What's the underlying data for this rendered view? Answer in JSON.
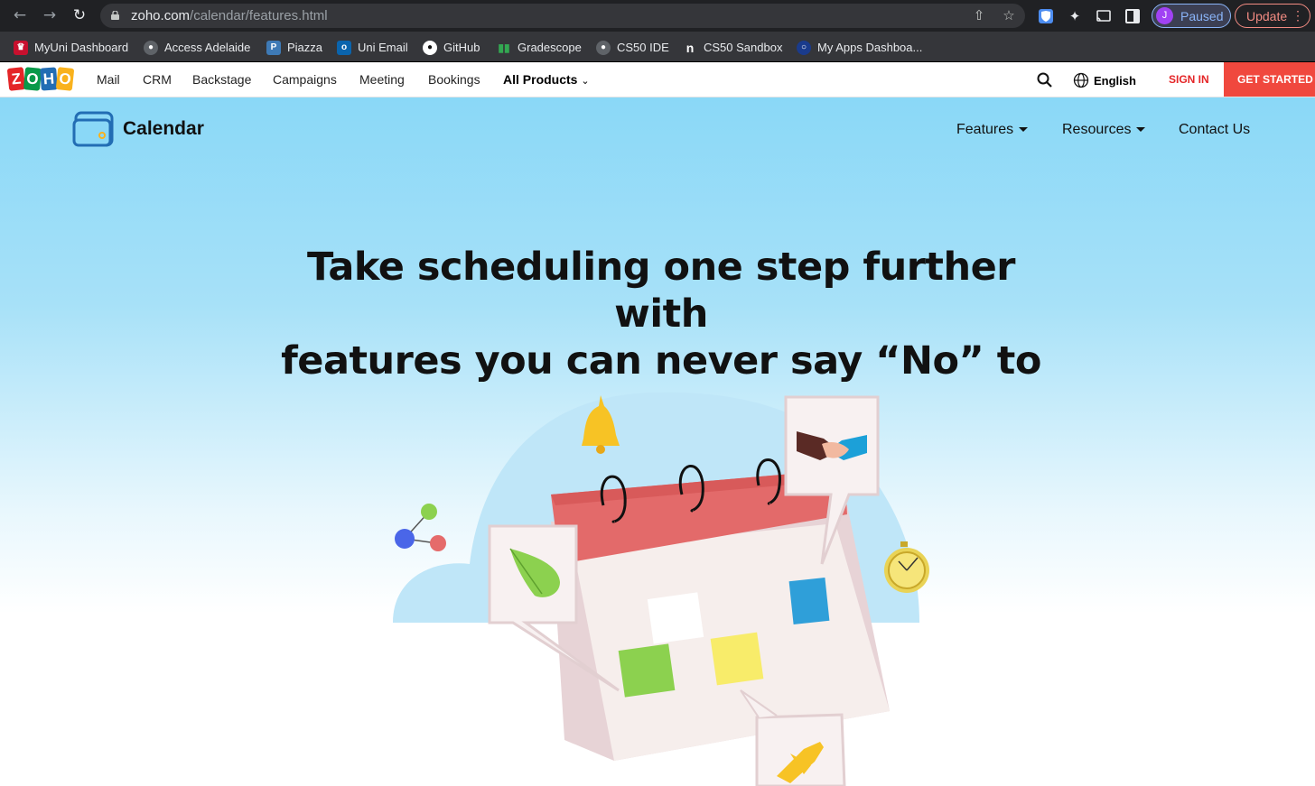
{
  "browser": {
    "back_icon": "back-arrow-icon",
    "forward_icon": "forward-arrow-icon",
    "reload_icon": "reload-icon",
    "url_host": "zoho.com",
    "url_path": "/calendar/features.html",
    "profile_initial": "J",
    "profile_label": "Paused",
    "update_label": "Update"
  },
  "bookmarks": [
    {
      "label": "MyUni Dashboard",
      "icon": "myuni-icon",
      "color": "#c8102e"
    },
    {
      "label": "Access Adelaide",
      "icon": "globe-icon",
      "color": "#5f6368"
    },
    {
      "label": "Piazza",
      "icon": "piazza-icon",
      "color": "#3e7ab6"
    },
    {
      "label": "Uni Email",
      "icon": "outlook-icon",
      "color": "#0a64ad"
    },
    {
      "label": "GitHub",
      "icon": "github-icon",
      "color": "#ffffff"
    },
    {
      "label": "Gradescope",
      "icon": "gradescope-icon",
      "color": "#33a852"
    },
    {
      "label": "CS50 IDE",
      "icon": "globe-icon",
      "color": "#5f6368"
    },
    {
      "label": "CS50 Sandbox",
      "icon": "sandbox-icon",
      "color": "#ffffff"
    },
    {
      "label": "My Apps Dashboa...",
      "icon": "apps-icon",
      "color": "#1a3b8c"
    }
  ],
  "zoho": {
    "logo_letters": [
      "Z",
      "O",
      "H",
      "O"
    ],
    "logo_colors": [
      "#e42527",
      "#089949",
      "#226db4",
      "#f9b21d"
    ],
    "nav": [
      "Mail",
      "CRM",
      "Backstage",
      "Campaigns",
      "Meeting",
      "Bookings"
    ],
    "all_products": "All Products",
    "language": "English",
    "sign_in": "SIGN IN",
    "get_started": "GET STARTED"
  },
  "calendar": {
    "brand": "Calendar",
    "nav": {
      "features": "Features",
      "resources": "Resources",
      "contact": "Contact Us"
    },
    "headline_line1": "Take scheduling one step further with",
    "headline_line2": "features you can never say “No” to"
  }
}
